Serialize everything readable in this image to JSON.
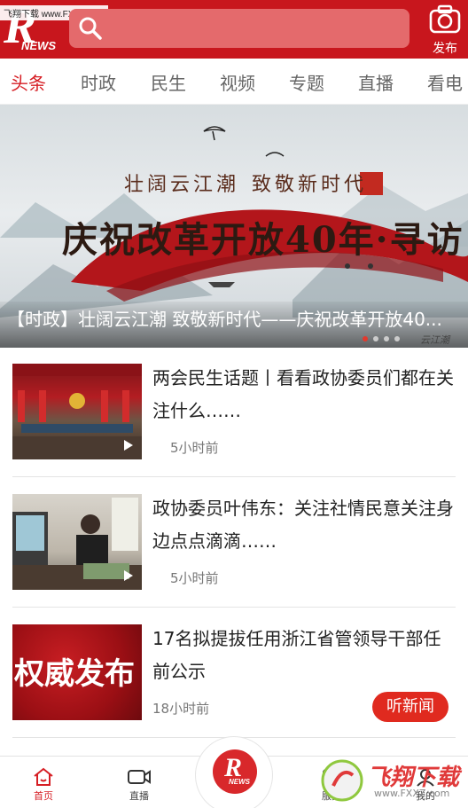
{
  "watermark_top": "飞翔下载 www.FXXZ.com",
  "header": {
    "logo_letter": "R",
    "logo_sub": "NEWS",
    "publish_label": "发布"
  },
  "tabs": [
    {
      "label": "头条",
      "active": true
    },
    {
      "label": "时政"
    },
    {
      "label": "民生"
    },
    {
      "label": "视频"
    },
    {
      "label": "专题"
    },
    {
      "label": "直播"
    },
    {
      "label": "看电"
    }
  ],
  "banner": {
    "line1": "壮阔云江潮",
    "line2": "致敬新时代",
    "title": "庆祝改革开放40年·寻访",
    "caption": "【时政】壮阔云江潮 致敬新时代——庆祝改革开放40...",
    "source": "云江潮"
  },
  "articles": [
    {
      "title": "两会民生话题丨看看政协委员们都在关注什么……",
      "time": "5小时前",
      "has_video": true
    },
    {
      "title": "政协委员叶伟东：关注社情民意关注身边点点滴滴……",
      "time": "5小时前",
      "has_video": true
    },
    {
      "title": "17名拟提拔任用浙江省管领导干部任前公示",
      "time": "18小时前",
      "thumb_text": "权威发布",
      "listen_label": "听新闻"
    }
  ],
  "bottom_nav": [
    {
      "label": "首页",
      "icon": "home-icon",
      "active": true
    },
    {
      "label": "直播",
      "icon": "video-camera-icon"
    },
    {
      "label": "",
      "icon": "r-news-logo-icon"
    },
    {
      "label": "服务",
      "icon": "service-icon"
    },
    {
      "label": "我的",
      "icon": "user-icon"
    }
  ],
  "center_logo": {
    "letter": "R",
    "sub": "NEWS"
  },
  "watermark_bottom": {
    "text": "飞翔下载",
    "url": "www.FXXZ.com"
  },
  "colors": {
    "brand_red": "#c8161d",
    "accent": "#d61e24"
  }
}
